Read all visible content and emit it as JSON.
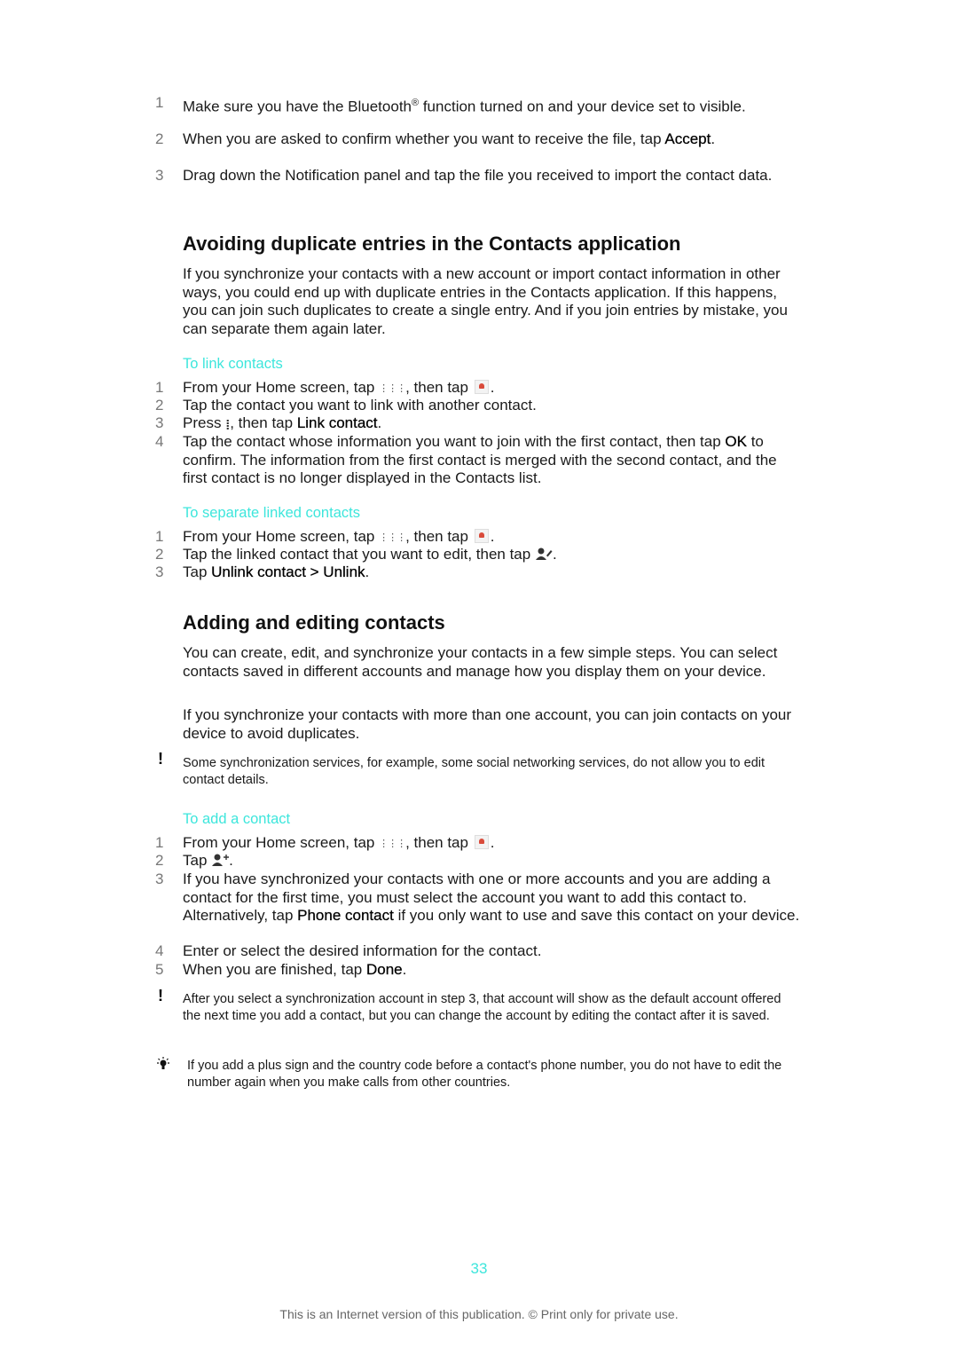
{
  "intro_steps": [
    {
      "num": "1",
      "text_a": "Make sure you have the Bluetooth",
      "sup": "®",
      "text_b": " function turned on and your device set to visible."
    },
    {
      "num": "2",
      "text_a": "When you are asked to confirm whether you want to receive the file, tap ",
      "bold": "Accept",
      "text_b": "."
    },
    {
      "num": "3",
      "text": "Drag down the Notification panel and tap the file you received to import the contact data."
    }
  ],
  "section1": {
    "heading": "Avoiding duplicate entries in the Contacts application",
    "paragraph": "If you synchronize your contacts with a new account or import contact information in other ways, you could end up with duplicate entries in the Contacts application. If this happens, you can join such duplicates to create a single entry. And if you join entries by mistake, you can separate them again later.",
    "link_title": "To link contacts",
    "link_steps": [
      {
        "num": "1",
        "text_a": "From your Home screen, tap ",
        "text_b": ", then tap ",
        "text_c": "."
      },
      {
        "num": "2",
        "text": "Tap the contact you want to link with another contact."
      },
      {
        "num": "3",
        "text_a": "Press ",
        "text_b": ", then tap ",
        "bold": "Link contact",
        "text_c": "."
      },
      {
        "num": "4",
        "text_a": "Tap the contact whose information you want to join with the first contact, then tap ",
        "bold": "OK",
        "text_b": " to confirm. The information from the first contact is merged with the second contact, and the first contact is no longer displayed in the Contacts list."
      }
    ],
    "separate_title": "To separate linked contacts",
    "separate_steps": [
      {
        "num": "1",
        "text_a": "From your Home screen, tap ",
        "text_b": ", then tap ",
        "text_c": "."
      },
      {
        "num": "2",
        "text_a": "Tap the linked contact that you want to edit, then tap ",
        "text_b": "."
      },
      {
        "num": "3",
        "text_a": "Tap ",
        "bold": "Unlink contact > Unlink",
        "text_b": "."
      }
    ]
  },
  "section2": {
    "heading": "Adding and editing contacts",
    "paragraph1": "You can create, edit, and synchronize your contacts in a few simple steps. You can select contacts saved in different accounts and manage how you display them on your device.",
    "paragraph2": "If you synchronize your contacts with more than one account, you can join contacts on your device to avoid duplicates.",
    "note1": "Some synchronization services, for example, some social networking services, do not allow you to edit contact details.",
    "add_title": "To add a contact",
    "add_steps": [
      {
        "num": "1",
        "text_a": "From your Home screen, tap ",
        "text_b": ", then tap ",
        "text_c": "."
      },
      {
        "num": "2",
        "text_a": "Tap ",
        "text_b": "."
      },
      {
        "num": "3",
        "text_a": "If you have synchronized your contacts with one or more accounts and you are adding a contact for the first time, you must select the account you want to add this contact to. Alternatively, tap ",
        "bold": "Phone contact",
        "text_b": " if you only want to use and save this contact on your device."
      },
      {
        "num": "4",
        "text": "Enter or select the desired information for the contact."
      },
      {
        "num": "5",
        "text_a": "When you are finished, tap ",
        "bold": "Done",
        "text_b": "."
      }
    ],
    "note2": "After you select a synchronization account in step 3, that account will show as the default account offered the next time you add a contact, but you can change the account by editing the contact after it is saved.",
    "tip": "If you add a plus sign and the country code before a contact's phone number, you do not have to edit the number again when you make calls from other countries."
  },
  "icons": {
    "note_glyph": "!",
    "grid_glyph": "⋮⋮⋮",
    "menu_glyph": "⁞"
  },
  "page_number": "33",
  "footer": "This is an Internet version of this publication. © Print only for private use.",
  "colors": {
    "accent": "#3de6dc",
    "step_number": "#777777"
  }
}
